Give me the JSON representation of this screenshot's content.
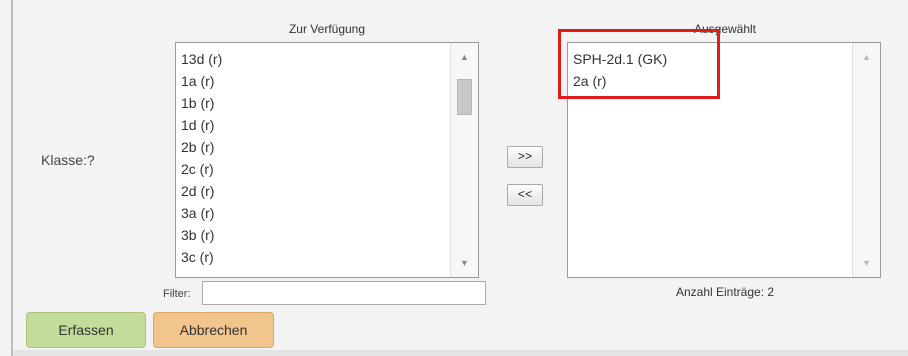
{
  "form": {
    "field_label": "Klasse:?",
    "available": {
      "title": "Zur Verfügung",
      "items": [
        "13d (r)",
        "1a (r)",
        "1b (r)",
        "1d (r)",
        "2b (r)",
        "2c (r)",
        "2d (r)",
        "3a (r)",
        "3b (r)",
        "3c (r)"
      ]
    },
    "selected": {
      "title": "Ausgewählt",
      "items": [
        "SPH-2d.1 (GK)",
        "2a (r)"
      ],
      "count_text": "Anzahl Einträge: 2"
    },
    "buttons": {
      "add_label": ">>",
      "remove_label": "<<",
      "save_label": "Erfassen",
      "cancel_label": "Abbrechen"
    },
    "filter": {
      "label": "Filter:",
      "value": ""
    }
  },
  "icons": {
    "scroll_up": "up-arrow-icon",
    "scroll_down": "down-arrow-icon"
  },
  "colors": {
    "save_button": "#c3dc9a",
    "cancel_button": "#f2c48e",
    "highlight": "#e01b1b"
  }
}
